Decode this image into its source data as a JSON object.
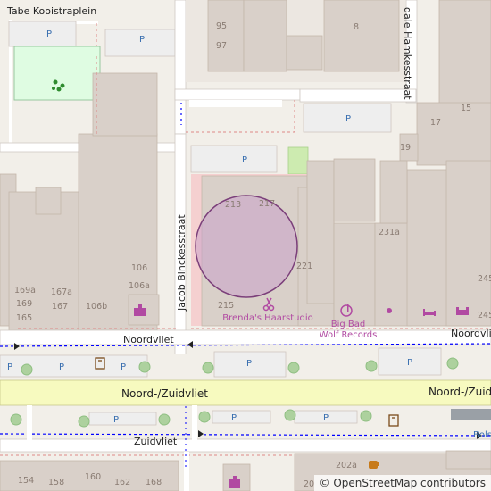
{
  "streets": {
    "tabe_kooistraplein": "Tabe Kooistraplein",
    "dale_hamkesstraat": "dale Hamkesstraat",
    "jacob_binckesstraat": "Jacob Binckesstraat",
    "noordvliet_1": "Noordvliet",
    "noordvliet_2": "Noordvlie",
    "noord_zuidvliet_1": "Noord-/Zuidvliet",
    "noord_zuidvliet_2": "Noord-/Zuidv",
    "zuidvliet": "Zuidvliet"
  },
  "house_numbers": {
    "n95": "95",
    "n97": "97",
    "n8": "8",
    "n17": "17",
    "n15": "15",
    "n19": "19",
    "n213": "213",
    "n217": "217",
    "n215": "215",
    "n221": "221",
    "n231a": "231a",
    "n245a": "245",
    "n245b": "245",
    "n106": "106",
    "n106a": "106a",
    "n106b": "106b",
    "n169a": "169a",
    "n167a": "167a",
    "n169": "169",
    "n167": "167",
    "n165": "165",
    "n154": "154",
    "n158": "158",
    "n160": "160",
    "n162": "162",
    "n168": "168",
    "n20": "20",
    "n202a": "202a"
  },
  "parking_label": "P",
  "pois": {
    "hair_salon": "Brenda's Haarstudio",
    "record_store_line1": "Big Bad",
    "record_store_line2": "Wolf Records"
  },
  "edge_text": {
    "bols": "Bols"
  },
  "attribution": "© OpenStreetMap contributors",
  "icons": [
    "playground-icon",
    "hairdresser-icon",
    "music-store-icon",
    "shop-icon",
    "furniture-store-icon",
    "bed-icon",
    "bench-icon",
    "parking-icon",
    "cafe-icon",
    "gift-icon",
    "tree-icon"
  ],
  "colors": {
    "background": "#f2efe9",
    "building": "#d9d0c9",
    "main_road": "#f7fabf",
    "footway": "#ffffff",
    "cycleway": "#0000ff",
    "poi": "#b14aa2",
    "parking": "#3a6fb0",
    "circle_fill": "#c9a0c8",
    "circle_stroke": "#7b3f7a"
  }
}
